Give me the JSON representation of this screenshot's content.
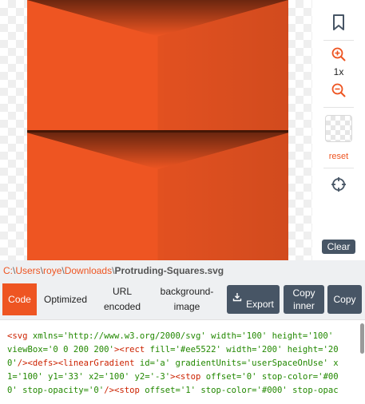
{
  "colors": {
    "accent": "#ee5522",
    "button_bg": "#475565",
    "path_bar_bg": "#eef0f2",
    "code_tag": "#cc2200",
    "code_attr": "#228800"
  },
  "toolbar": {
    "bookmark_icon": "bookmark-icon",
    "zoom_in_icon": "zoom-in-icon",
    "zoom_level": "1x",
    "zoom_out_icon": "zoom-out-icon",
    "background_swatch": "transparent-checkerboard",
    "reset_label": "reset",
    "locate_icon": "crosshair-icon",
    "clear_label": "Clear"
  },
  "path": {
    "segments": [
      "C:",
      "Users",
      "roye",
      "Downloads"
    ],
    "separator": "\\",
    "filename": "Protruding-Squares.svg"
  },
  "tabs": [
    {
      "label": "Code",
      "active": true
    },
    {
      "label": "Optimized",
      "active": false
    },
    {
      "label": "URL encoded",
      "active": false
    },
    {
      "label": "background-image",
      "active": false
    }
  ],
  "actions": {
    "export_label": "Export",
    "export_icon": "download-icon",
    "copy_inner_label": "Copy inner",
    "copy_label": "Copy"
  },
  "code": {
    "lines": [
      [
        [
          "tag",
          "<svg "
        ],
        [
          "attr",
          "xmlns='http://www.w3.org/2000/svg' width='100' height='100'"
        ]
      ],
      [
        [
          "attr",
          "viewBox='0 0 200 200'"
        ],
        [
          "tag",
          "><rect "
        ],
        [
          "attr",
          "fill='#ee5522' width='200' height='20"
        ]
      ],
      [
        [
          "attr",
          "0'"
        ],
        [
          "tag",
          "/><defs><linearGradient "
        ],
        [
          "attr",
          "id='a' gradientUnits='userSpaceOnUse' x"
        ]
      ],
      [
        [
          "attr",
          "1='100' y1='33' x2='100' y2='-3'"
        ],
        [
          "tag",
          "><stop "
        ],
        [
          "attr",
          "offset='0' stop-color='#00"
        ]
      ],
      [
        [
          "attr",
          "0' stop-opacity='0'"
        ],
        [
          "tag",
          "/><stop "
        ],
        [
          "attr",
          "offset='1' stop-color='#000' stop-opac"
        ]
      ]
    ]
  }
}
